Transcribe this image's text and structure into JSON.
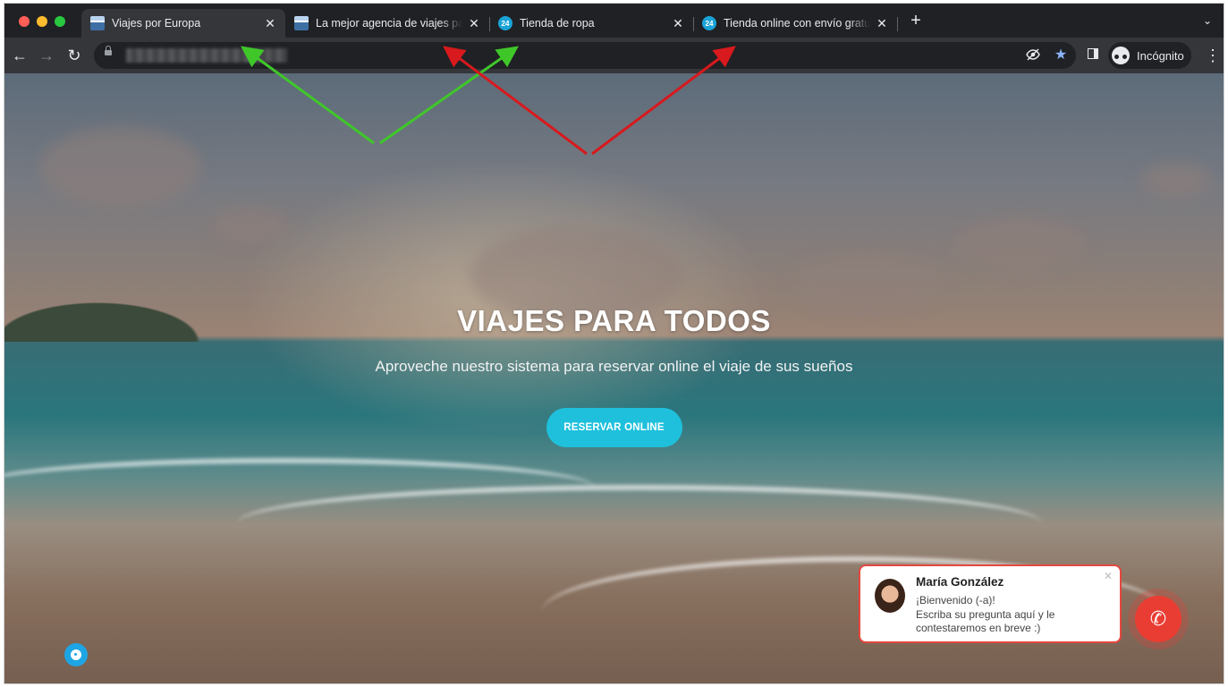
{
  "browser": {
    "tabs": [
      {
        "title": "Viajes por Europa",
        "favicon": "landscape-favicon",
        "active": true
      },
      {
        "title": "La mejor agencia de viajes para",
        "favicon": "landscape-favicon",
        "active": false
      },
      {
        "title": "Tienda de ropa",
        "favicon": "24-favicon",
        "favicon_text": "24",
        "active": false
      },
      {
        "title": "Tienda online con envío gratuito",
        "favicon": "24-favicon",
        "favicon_text": "24",
        "active": false
      }
    ],
    "profile_label": "Incógnito",
    "icons": {
      "back": "arrow-left-icon",
      "forward": "arrow-right-icon",
      "reload": "reload-icon",
      "lock": "lock-icon",
      "eye_off": "eye-off-icon",
      "bookmark": "star-icon",
      "side_panel": "side-panel-icon",
      "menu": "kebab-menu-icon"
    }
  },
  "hero": {
    "title": "VIAJES PARA TODOS",
    "subtitle": "Aproveche nuestro sistema para reservar online el viaje de sus sueños",
    "cta_label": "RESERVAR ONLINE"
  },
  "chat_widget": {
    "agent_name": "María González",
    "message_line1": "¡Bienvenido (-a)!",
    "message_line2": "Escriba su pregunta aquí y le",
    "message_line3": "contestaremos en breve :)"
  },
  "colors": {
    "accent": "#1ec0dc",
    "chat_border": "#e5483f",
    "call_button": "#e93d33",
    "arrow_green": "#3fc72a",
    "arrow_red": "#d8191d"
  }
}
